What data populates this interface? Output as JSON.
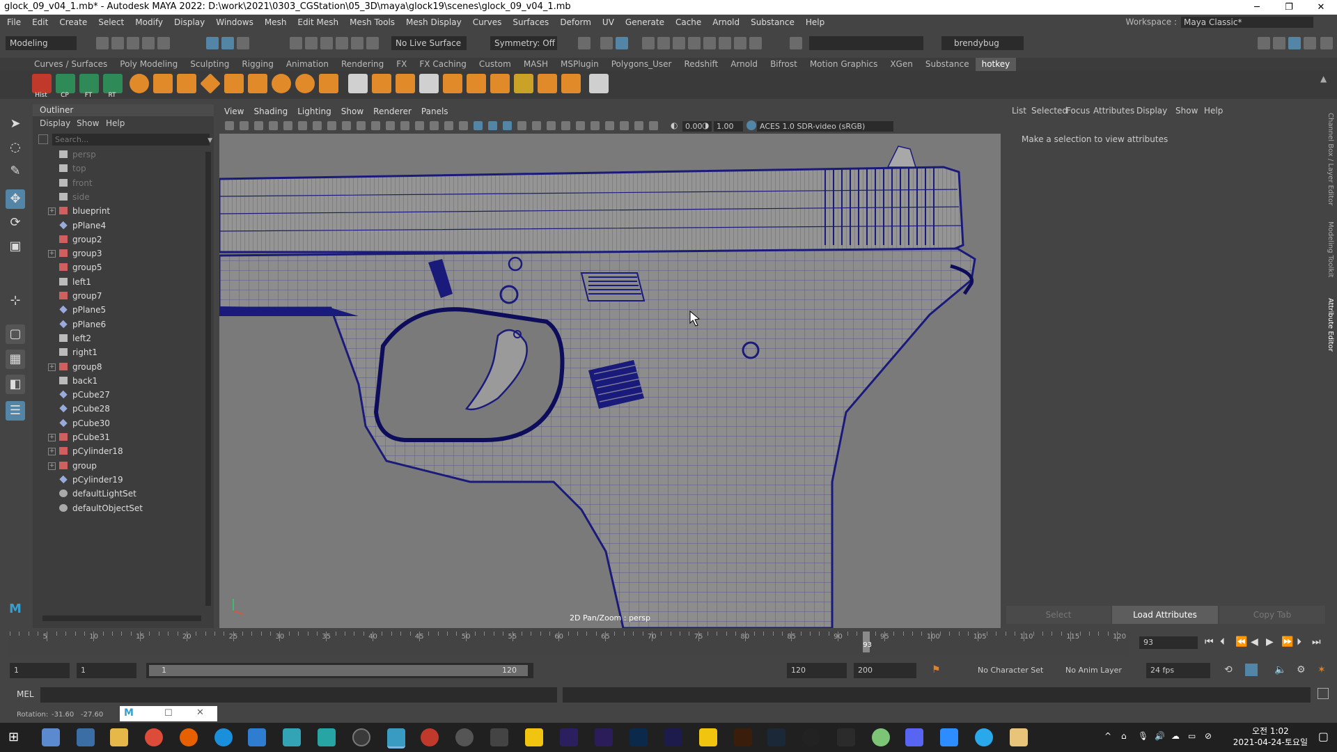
{
  "window": {
    "title": "glock_09_v04_1.mb* - Autodesk MAYA 2022: D:\\work\\2021\\0303_CGStation\\05_3D\\maya\\glock19\\scenes\\glock_09_v04_1.mb",
    "minimize": "─",
    "maximize": "❐",
    "close": "✕"
  },
  "menus": [
    "File",
    "Edit",
    "Create",
    "Select",
    "Modify",
    "Display",
    "Windows",
    "Mesh",
    "Edit Mesh",
    "Mesh Tools",
    "Mesh Display",
    "Curves",
    "Surfaces",
    "Deform",
    "UV",
    "Generate",
    "Cache",
    "Arnold",
    "Substance",
    "Help"
  ],
  "workspace": {
    "label": "Workspace :",
    "value": "Maya Classic*"
  },
  "statusline": {
    "mode": "Modeling",
    "live_surface": "No Live Surface",
    "symmetry": "Symmetry: Off",
    "user": "brendybug"
  },
  "shelf": {
    "tabs": [
      "Curves / Surfaces",
      "Poly Modeling",
      "Sculpting",
      "Rigging",
      "Animation",
      "Rendering",
      "FX",
      "FX Caching",
      "Custom",
      "MASH",
      "MSPlugin",
      "Polygons_User",
      "Redshift",
      "Arnold",
      "Bifrost",
      "Motion Graphics",
      "XGen",
      "Substance",
      "hotkey"
    ],
    "active_tab": "hotkey",
    "icon_labels": [
      "Hist",
      "CP",
      "FT",
      "RT"
    ]
  },
  "outliner": {
    "title": "Outliner",
    "menus": [
      "Display",
      "Show",
      "Help"
    ],
    "search_placeholder": "Search...",
    "items": [
      {
        "label": "persp",
        "type": "camera",
        "dim": true,
        "expand": false
      },
      {
        "label": "top",
        "type": "camera",
        "dim": true,
        "expand": false
      },
      {
        "label": "front",
        "type": "camera",
        "dim": true,
        "expand": false
      },
      {
        "label": "side",
        "type": "camera",
        "dim": true,
        "expand": false
      },
      {
        "label": "blueprint",
        "type": "group",
        "dim": false,
        "expand": true
      },
      {
        "label": "pPlane4",
        "type": "mesh",
        "dim": false,
        "expand": false
      },
      {
        "label": "group2",
        "type": "group",
        "dim": false,
        "expand": false
      },
      {
        "label": "group3",
        "type": "group",
        "dim": false,
        "expand": true
      },
      {
        "label": "group5",
        "type": "group",
        "dim": false,
        "expand": false
      },
      {
        "label": "left1",
        "type": "camera",
        "dim": false,
        "expand": false
      },
      {
        "label": "group7",
        "type": "group",
        "dim": false,
        "expand": false
      },
      {
        "label": "pPlane5",
        "type": "mesh",
        "dim": false,
        "expand": false
      },
      {
        "label": "pPlane6",
        "type": "mesh",
        "dim": false,
        "expand": false
      },
      {
        "label": "left2",
        "type": "camera",
        "dim": false,
        "expand": false
      },
      {
        "label": "right1",
        "type": "camera",
        "dim": false,
        "expand": false
      },
      {
        "label": "group8",
        "type": "group",
        "dim": false,
        "expand": true
      },
      {
        "label": "back1",
        "type": "camera",
        "dim": false,
        "expand": false
      },
      {
        "label": "pCube27",
        "type": "mesh",
        "dim": false,
        "expand": false
      },
      {
        "label": "pCube28",
        "type": "mesh",
        "dim": false,
        "expand": false
      },
      {
        "label": "pCube30",
        "type": "mesh",
        "dim": false,
        "expand": false
      },
      {
        "label": "pCube31",
        "type": "group",
        "dim": false,
        "expand": true
      },
      {
        "label": "pCylinder18",
        "type": "group",
        "dim": false,
        "expand": true
      },
      {
        "label": "group",
        "type": "group",
        "dim": false,
        "expand": true
      },
      {
        "label": "pCylinder19",
        "type": "mesh",
        "dim": false,
        "expand": false
      },
      {
        "label": "defaultLightSet",
        "type": "set",
        "dim": false,
        "expand": false
      },
      {
        "label": "defaultObjectSet",
        "type": "set",
        "dim": false,
        "expand": false
      }
    ]
  },
  "viewport": {
    "menus": [
      "View",
      "Shading",
      "Lighting",
      "Show",
      "Renderer",
      "Panels"
    ],
    "exposure": "0.00",
    "gamma": "1.00",
    "colorspace": "ACES 1.0 SDR-video (sRGB)",
    "status_label": "2D Pan/Zoom : persp"
  },
  "attribute_editor": {
    "menus": [
      "List",
      "Selected",
      "Focus",
      "Attributes",
      "Display",
      "Show",
      "Help"
    ],
    "message": "Make a selection to view attributes",
    "buttons": [
      "Select",
      "Load Attributes",
      "Copy Tab"
    ],
    "side_tabs": [
      "Channel Box / Layer Editor",
      "Modeling Toolkit",
      "Attribute Editor"
    ]
  },
  "timeline": {
    "labels": [
      "5",
      "10",
      "15",
      "20",
      "25",
      "30",
      "35",
      "40",
      "45",
      "50",
      "55",
      "60",
      "65",
      "70",
      "75",
      "80",
      "85",
      "90",
      "95",
      "100",
      "105",
      "110",
      "115",
      "120"
    ],
    "current_frame": "93",
    "current_frame_field": "93",
    "range_start": 1,
    "range_end": 120
  },
  "range": {
    "start": "1",
    "inner_start": "1",
    "slider_start": "1",
    "slider_end": "120",
    "end": "120",
    "outer_end": "200",
    "character_set": "No Character Set",
    "anim_layer": "No Anim Layer",
    "fps": "24 fps"
  },
  "command": {
    "lang": "MEL"
  },
  "help": {
    "label": "Rotation:",
    "x": "-31.60",
    "y": "-27.60"
  },
  "taskbar": {
    "time": "오전 1:02",
    "date": "2021-04-24-토요일",
    "tray": "^"
  },
  "colors": {
    "accent": "#5285a6",
    "wire": "#1a1a7a",
    "active_tab": "#5a5a5a"
  }
}
